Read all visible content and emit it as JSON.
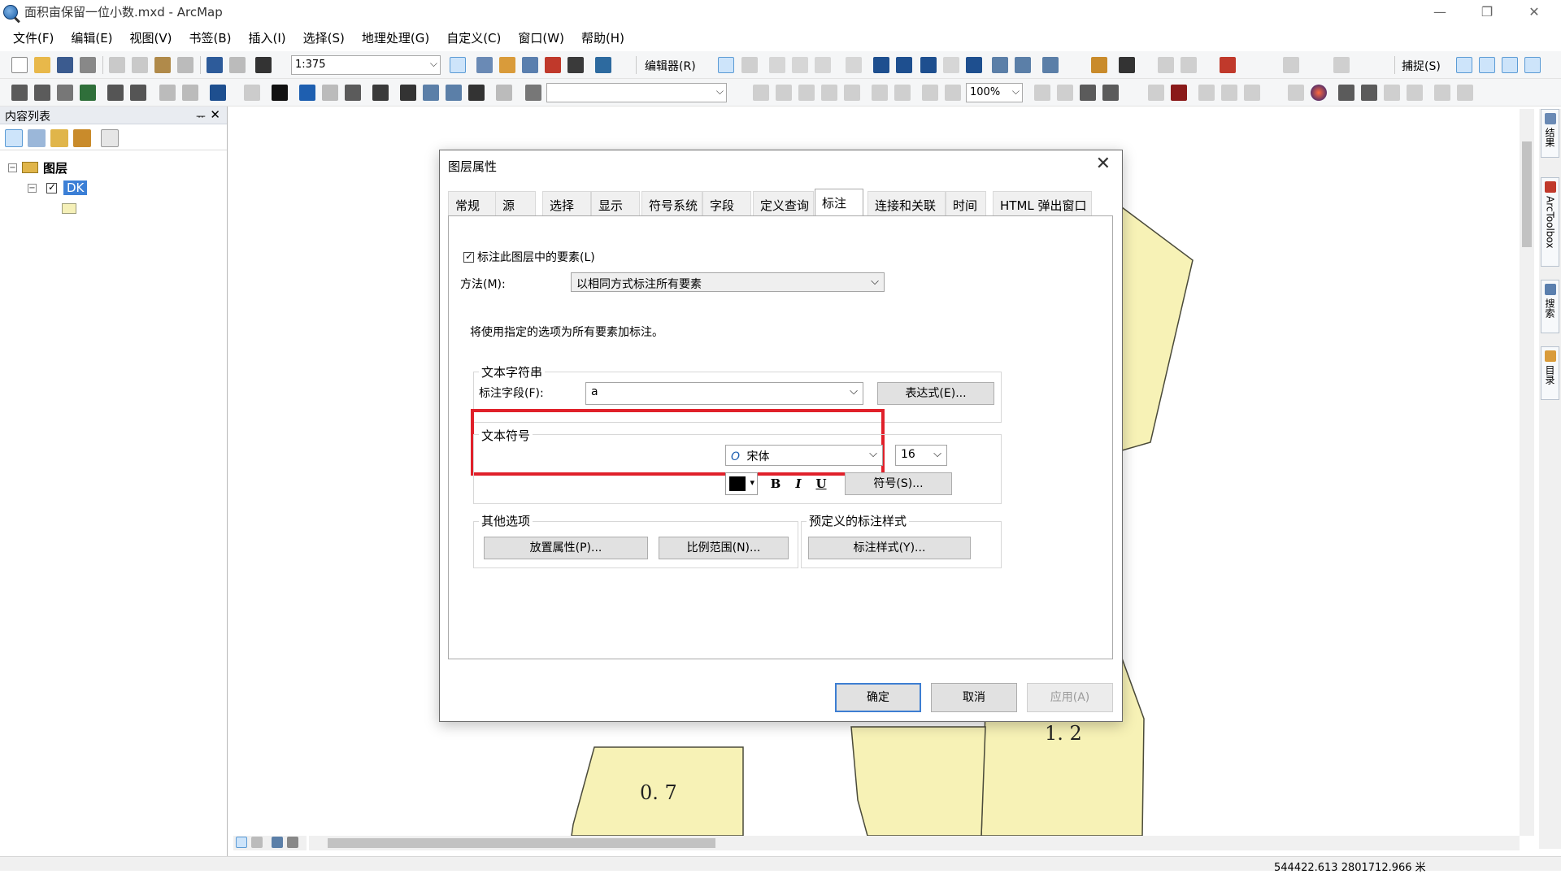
{
  "window": {
    "title": "面积亩保留一位小数.mxd - ArcMap",
    "minimize": "—",
    "restore": "❐",
    "close": "✕"
  },
  "menu": [
    "文件(F)",
    "编辑(E)",
    "视图(V)",
    "书签(B)",
    "插入(I)",
    "选择(S)",
    "地理处理(G)",
    "自定义(C)",
    "窗口(W)",
    "帮助(H)"
  ],
  "toolbar": {
    "scale_value": "1:375",
    "editor_label": "编辑器(R)",
    "snapping_label": "捕捉(S)",
    "zoom_percent": "100%"
  },
  "toc": {
    "title": "内容列表",
    "pin": "ᅲ",
    "close": "✕",
    "root_label": "图层",
    "layer_name": "DK"
  },
  "map": {
    "labels": [
      "0. 7",
      "1. 2"
    ],
    "fill_color": "#f7f2b6",
    "outline_color": "#4a4a3a"
  },
  "right_dock": {
    "tabs": [
      "结果",
      "ArcToolbox",
      "搜索",
      "目录"
    ]
  },
  "status": {
    "coordinates": "544422.613  2801712.966 米"
  },
  "dialog": {
    "title": "图层属性",
    "close": "✕",
    "tabs": [
      "常规",
      "源",
      "选择",
      "显示",
      "符号系统",
      "字段",
      "定义查询",
      "标注",
      "连接和关联",
      "时间",
      "HTML 弹出窗口"
    ],
    "active_tab": "标注",
    "label_features_checkbox": "标注此图层中的要素(L)",
    "method_label": "方法(M):",
    "method_value": "以相同方式标注所有要素",
    "info_text": "将使用指定的选项为所有要素加标注。",
    "text_string_group": "文本字符串",
    "label_field_label": "标注字段(F):",
    "label_field_value": "a",
    "expression_button": "表达式(E)...",
    "text_symbol_group": "文本符号",
    "font_name": "宋体",
    "font_size": "16",
    "bold": "B",
    "italic": "I",
    "underline": "U",
    "symbol_button": "符号(S)...",
    "other_options_group": "其他选项",
    "placement_button": "放置属性(P)...",
    "scale_range_button": "比例范围(N)...",
    "predefined_group": "预定义的标注样式",
    "label_styles_button": "标注样式(Y)...",
    "ok_button": "确定",
    "cancel_button": "取消",
    "apply_button": "应用(A)",
    "highlight_color": "#e0202a"
  }
}
